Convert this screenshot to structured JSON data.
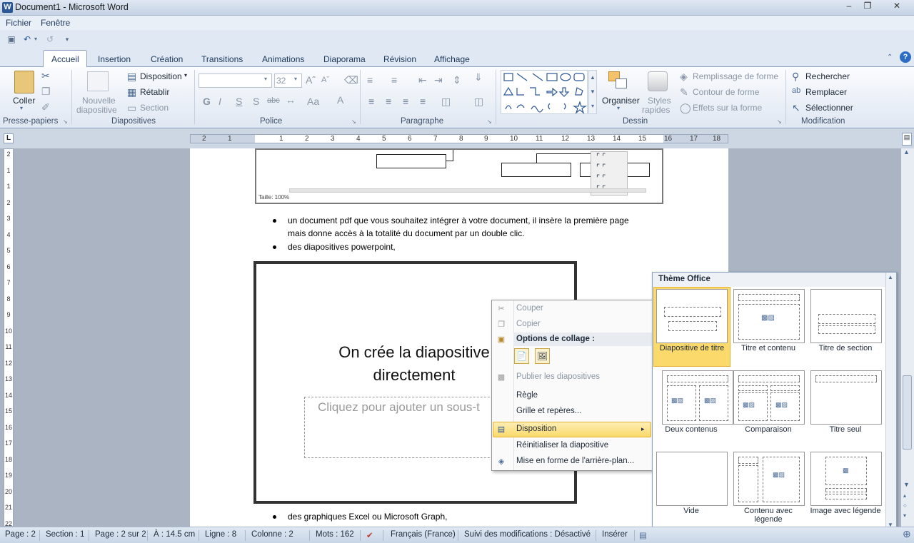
{
  "window": {
    "title": "Document1 - Microsoft Word",
    "app_icon": "W"
  },
  "menu": [
    "Fichier",
    "Fenêtre"
  ],
  "tabs": [
    "Accueil",
    "Insertion",
    "Création",
    "Transitions",
    "Animations",
    "Diaporama",
    "Révision",
    "Affichage"
  ],
  "ribbon": {
    "presse": {
      "coller": "Coller",
      "label": "Presse-papiers"
    },
    "diapos": {
      "nouvelle1": "Nouvelle",
      "nouvelle2": "diapositive",
      "disposition": "Disposition",
      "retablir": "Rétablir",
      "section": "Section",
      "label": "Diapositives"
    },
    "police": {
      "size": "32",
      "label": "Police"
    },
    "paragraphe": {
      "label": "Paragraphe"
    },
    "dessin": {
      "organiser": "Organiser",
      "styles1": "Styles",
      "styles2": "rapides",
      "remplissage": "Remplissage de forme",
      "contour": "Contour de forme",
      "effets": "Effets sur la forme",
      "label": "Dessin"
    },
    "modification": {
      "rechercher": "Rechercher",
      "remplacer": "Remplacer",
      "selectionner": "Sélectionner",
      "label": "Modification"
    }
  },
  "ruler": [
    "2",
    "1",
    "1",
    "2",
    "3",
    "4",
    "5",
    "6",
    "7",
    "8",
    "9",
    "10",
    "11",
    "12",
    "13",
    "14",
    "15",
    "16",
    "17",
    "18"
  ],
  "vruler": [
    "2",
    "1",
    "1",
    "2",
    "3",
    "4",
    "5",
    "6",
    "7",
    "8",
    "9",
    "10",
    "11",
    "12",
    "13",
    "14",
    "15",
    "16",
    "17",
    "18",
    "19",
    "20",
    "21",
    "22"
  ],
  "document": {
    "taille": "Taille: 100%",
    "bullet1_line1": "un document pdf que vous souhaitez intégrer à votre document, il insère la première page",
    "bullet1_line2": "mais donne accès à la totalité du document par un double clic.",
    "bullet2": "des diapositives powerpoint,",
    "bullet3": "des graphiques Excel ou Microsoft Graph,",
    "slide_title1": "On crée la diapositive",
    "slide_title2": "directement",
    "slide_sub": "Cliquez pour ajouter un sous-t"
  },
  "context_menu": {
    "couper": "Couper",
    "copier": "Copier",
    "options": "Options de collage :",
    "publier": "Publier les diapositives",
    "regle": "Règle",
    "grille": "Grille et repères...",
    "disposition": "Disposition",
    "reinit": "Réinitialiser la diapositive",
    "mise": "Mise en forme de l'arrière-plan..."
  },
  "gallery": {
    "header": "Thème Office",
    "items": [
      "Diapositive de titre",
      "Titre et contenu",
      "Titre de section",
      "Deux contenus",
      "Comparaison",
      "Titre seul",
      "Vide",
      "Contenu avec légende",
      "Image avec légende"
    ]
  },
  "status": {
    "page": "Page : 2",
    "section": "Section : 1",
    "pages": "Page : 2 sur 2",
    "a": "À : 14.5 cm",
    "ligne": "Ligne : 8",
    "colonne": "Colonne : 2",
    "mots": "Mots : 162",
    "langue": "Français (France)",
    "suivi": "Suivi des modifications : Désactivé",
    "inserer": "Insérer"
  },
  "colors": {
    "accent": "#2b5797",
    "selection": "#fbd96b"
  }
}
